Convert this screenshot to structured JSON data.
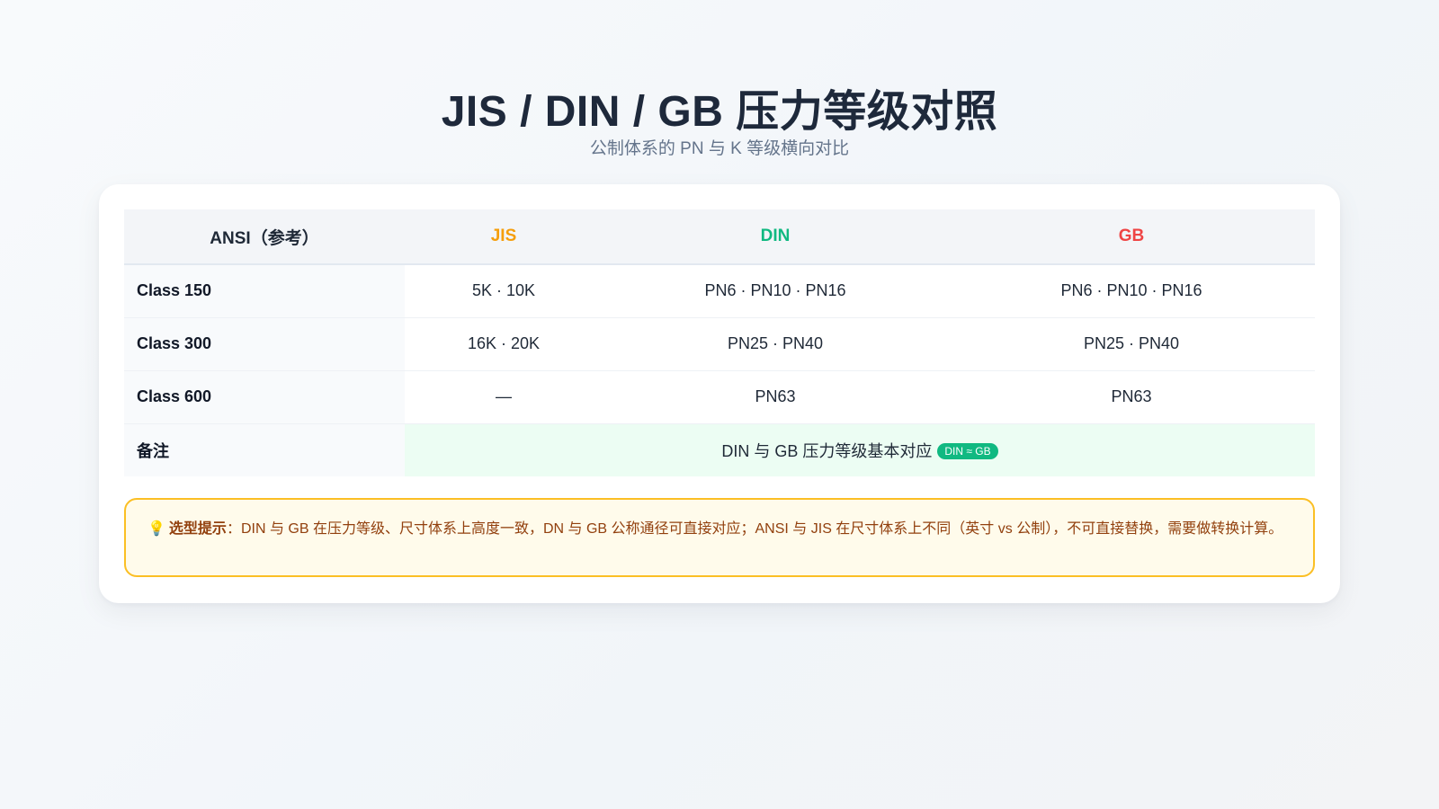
{
  "header": {
    "title": "JIS / DIN / GB 压力等级对照",
    "subtitle": "公制体系的 PN 与 K 等级横向对比"
  },
  "table": {
    "columns": [
      {
        "label": "ANSI（参考）",
        "color": "#1f2937"
      },
      {
        "label": "JIS",
        "color": "#f59e0b"
      },
      {
        "label": "DIN",
        "color": "#10b981"
      },
      {
        "label": "GB",
        "color": "#ef4444"
      }
    ],
    "rows": [
      {
        "ansi": "Class 150",
        "jis": "5K · 10K",
        "din": "PN6 · PN10 · PN16",
        "gb": "PN6 · PN10 · PN16"
      },
      {
        "ansi": "Class 300",
        "jis": "16K · 20K",
        "din": "PN25 · PN40",
        "gb": "PN25 · PN40"
      },
      {
        "ansi": "Class 600",
        "jis": "—",
        "din": "PN63",
        "gb": "PN63"
      }
    ],
    "note": {
      "label": "备注",
      "text": "DIN 与 GB 压力等级基本对应",
      "badge": "DIN ≈ GB"
    }
  },
  "tip": {
    "icon": "lightbulb-icon",
    "label": "选型提示",
    "text": "：DIN 与 GB 在压力等级、尺寸体系上高度一致，DN 与 GB 公称通径可直接对应；ANSI 与 JIS 在尺寸体系上不同（英寸 vs 公制），不可直接替换，需要做转换计算。"
  }
}
